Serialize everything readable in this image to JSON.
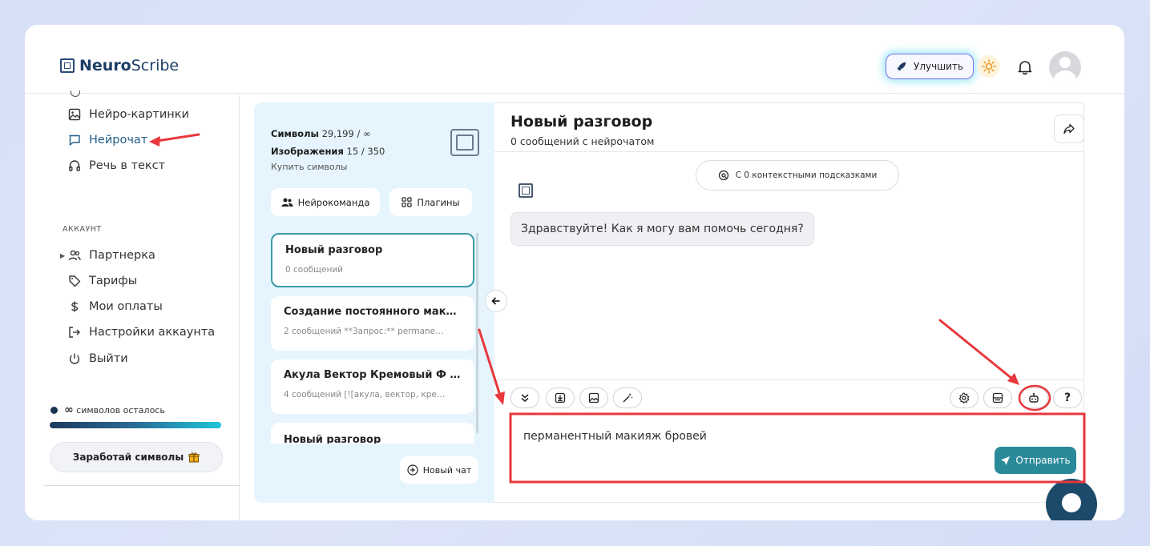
{
  "header": {
    "logo_bold": "Neuro",
    "logo_light": "Scribe",
    "upgrade_label": "Улучшить"
  },
  "sidebar": {
    "items": [
      {
        "label": "Нейро-картинки",
        "icon": "image-icon"
      },
      {
        "label": "Нейрочат",
        "icon": "chat-icon"
      },
      {
        "label": "Речь в текст",
        "icon": "headphones-icon"
      }
    ],
    "section_label": "АККАУНТ",
    "account_items": [
      {
        "label": "Партнерка",
        "icon": "users-icon"
      },
      {
        "label": "Тарифы",
        "icon": "tag-icon"
      },
      {
        "label": "Мои оплаты",
        "icon": "dollar-icon"
      },
      {
        "label": "Настройки аккаунта",
        "icon": "login-icon"
      },
      {
        "label": "Выйти",
        "icon": "power-icon"
      }
    ],
    "symbols_left_infinity": "∞",
    "symbols_left_label": "символов осталось",
    "earn_label": "Заработай символы"
  },
  "mid": {
    "symbols_label": "Символы",
    "symbols_value": "29,199 / ∞",
    "images_label": "Изображения",
    "images_value": "15 / 350",
    "buy_label": "Купить символы",
    "team_label": "Нейрокоманда",
    "plugins_label": "Плагины",
    "conversations": [
      {
        "title": "Новый разговор",
        "sub": "0 сообщений"
      },
      {
        "title": "Создание постоянного мак…",
        "sub": "2 сообщений    **Запрос:** permane…"
      },
      {
        "title": "Акула Вектор Кремовый Ф …",
        "sub": "4 сообщений    [![акула, вектор, кре…"
      },
      {
        "title": "Новый разговор",
        "sub": ""
      }
    ],
    "new_chat_label": "Новый чат"
  },
  "chat": {
    "title": "Новый разговор",
    "subtitle": "0 сообщений с нейрочатом",
    "context_label": "С 0 контекстными подсказками",
    "bot_message": "Здравствуйте! Как я могу вам помочь сегодня?",
    "input_value": "перманентный макияж бровей",
    "send_label": "Отправить",
    "help_label": "?"
  },
  "colors": {
    "accent": "#2a8a9a",
    "annotation": "#e8383d",
    "brand_dark": "#1d3d66"
  }
}
